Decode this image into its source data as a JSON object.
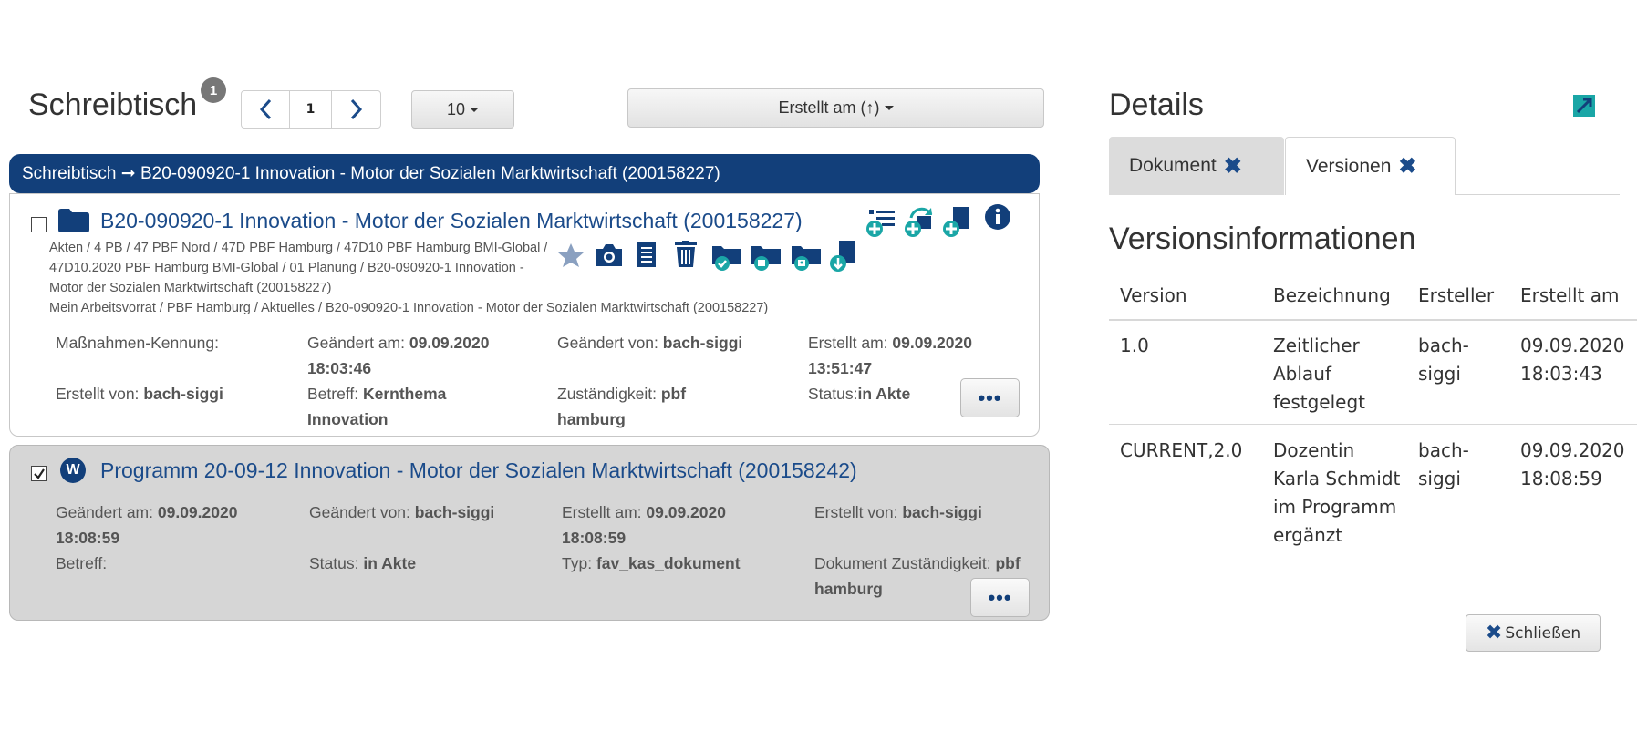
{
  "desk": {
    "title": "Schreibtisch",
    "badge": "1",
    "page": "1",
    "per_page": "10",
    "sort": "Erstellt am (↑)"
  },
  "breadcrumb": "Schreibtisch ➞ B20-090920-1 Innovation - Motor der Sozialen Marktwirtschaft (200158227)",
  "card1": {
    "title": "B20-090920-1 Innovation - Motor der Sozialen Marktwirtschaft (200158227)",
    "path1": "Akten / 4 PB / 47 PBF Nord / 47D PBF Hamburg / 47D10 PBF Hamburg BMI-Global / 47D10.2020 PBF Hamburg BMI-Global / 01 Planung / B20-090920-1 Innovation - Motor der Sozialen Marktwirtschaft (200158227)",
    "path2": "Mein Arbeitsvorrat / PBF Hamburg / Aktuelles / B20-090920-1 Innovation - Motor der Sozialen Marktwirtschaft (200158227)",
    "massnahmen_label": "Maßnahmen-Kennung:",
    "geaendert_am_label": "Geändert am:",
    "geaendert_am_value": "09.09.2020 18:03:46",
    "geaendert_von_label": "Geändert von:",
    "geaendert_von_value": "bach-siggi",
    "erstellt_am_label": "Erstellt am:",
    "erstellt_am_value": "09.09.2020 13:51:47",
    "erstellt_von_label": "Erstellt von:",
    "erstellt_von_value": "bach-siggi",
    "betreff_label": "Betreff:",
    "betreff_value": "Kernthema Innovation",
    "zustaendigkeit_label": "Zuständigkeit:",
    "zustaendigkeit_value": "pbf hamburg",
    "status_label": "Status:",
    "status_value": "in Akte",
    "more": "•••"
  },
  "card2": {
    "title": "Programm 20-09-12 Innovation - Motor der Sozialen Marktwirtschaft (200158242)",
    "doc_icon_letter": "W",
    "geaendert_am_label": "Geändert am:",
    "geaendert_am_value": "09.09.2020 18:08:59",
    "geaendert_von_label": "Geändert von:",
    "geaendert_von_value": "bach-siggi",
    "erstellt_am_label": "Erstellt am:",
    "erstellt_am_value": "09.09.2020 18:08:59",
    "erstellt_von_label": "Erstellt von:",
    "erstellt_von_value": "bach-siggi",
    "betreff_label": "Betreff:",
    "status_label": "Status:",
    "status_value": "in Akte",
    "typ_label": "Typ:",
    "typ_value": "fav_kas_dokument",
    "zustaendigkeit_label": "Dokument Zuständigkeit:",
    "zustaendigkeit_value": "pbf hamburg",
    "more": "•••"
  },
  "details": {
    "title": "Details",
    "tabs": [
      "Dokument",
      "Versionen"
    ],
    "heading": "Versionsinformationen",
    "columns": [
      "Version",
      "Bezeichnung",
      "Ersteller",
      "Erstellt am"
    ],
    "rows": [
      {
        "version": "1.0",
        "bezeichnung": "Zeitlicher Ablauf festgelegt",
        "ersteller": "bach-siggi",
        "erstellt_am": "09.09.2020 18:03:43"
      },
      {
        "version": "CURRENT,2.0",
        "bezeichnung": "Dozentin Karla Schmidt im Programm ergänzt",
        "ersteller": "bach-siggi",
        "erstellt_am": "09.09.2020 18:08:59"
      }
    ],
    "close_label": "Schließen"
  },
  "colors": {
    "primary": "#123f7a",
    "link": "#1b4b8a",
    "teal": "#1aa6a6"
  }
}
